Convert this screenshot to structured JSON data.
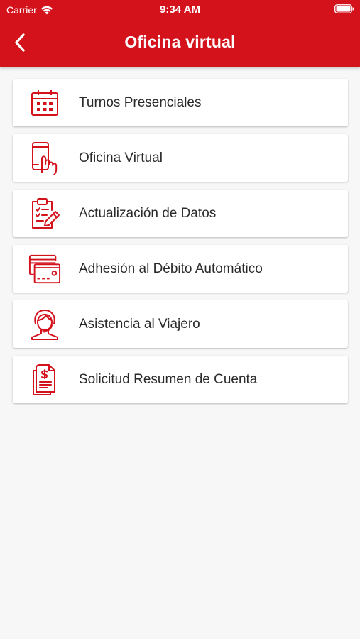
{
  "status_bar": {
    "carrier": "Carrier",
    "time": "9:34 AM"
  },
  "header": {
    "title": "Oficina virtual",
    "back_icon": "chevron-left-icon"
  },
  "colors": {
    "brand": "#d4121c",
    "background": "#f7f7f7",
    "card": "#ffffff",
    "text": "#2a2a2a"
  },
  "menu": {
    "items": [
      {
        "label": "Turnos Presenciales",
        "icon": "calendar-icon"
      },
      {
        "label": "Oficina Virtual",
        "icon": "phone-touch-icon"
      },
      {
        "label": "Actualización de Datos",
        "icon": "clipboard-edit-icon"
      },
      {
        "label": "Adhesión al Débito Automático",
        "icon": "credit-card-icon"
      },
      {
        "label": "Asistencia al Viajero",
        "icon": "support-agent-icon"
      },
      {
        "label": "Solicitud Resumen de Cuenta",
        "icon": "statement-document-icon"
      }
    ]
  }
}
